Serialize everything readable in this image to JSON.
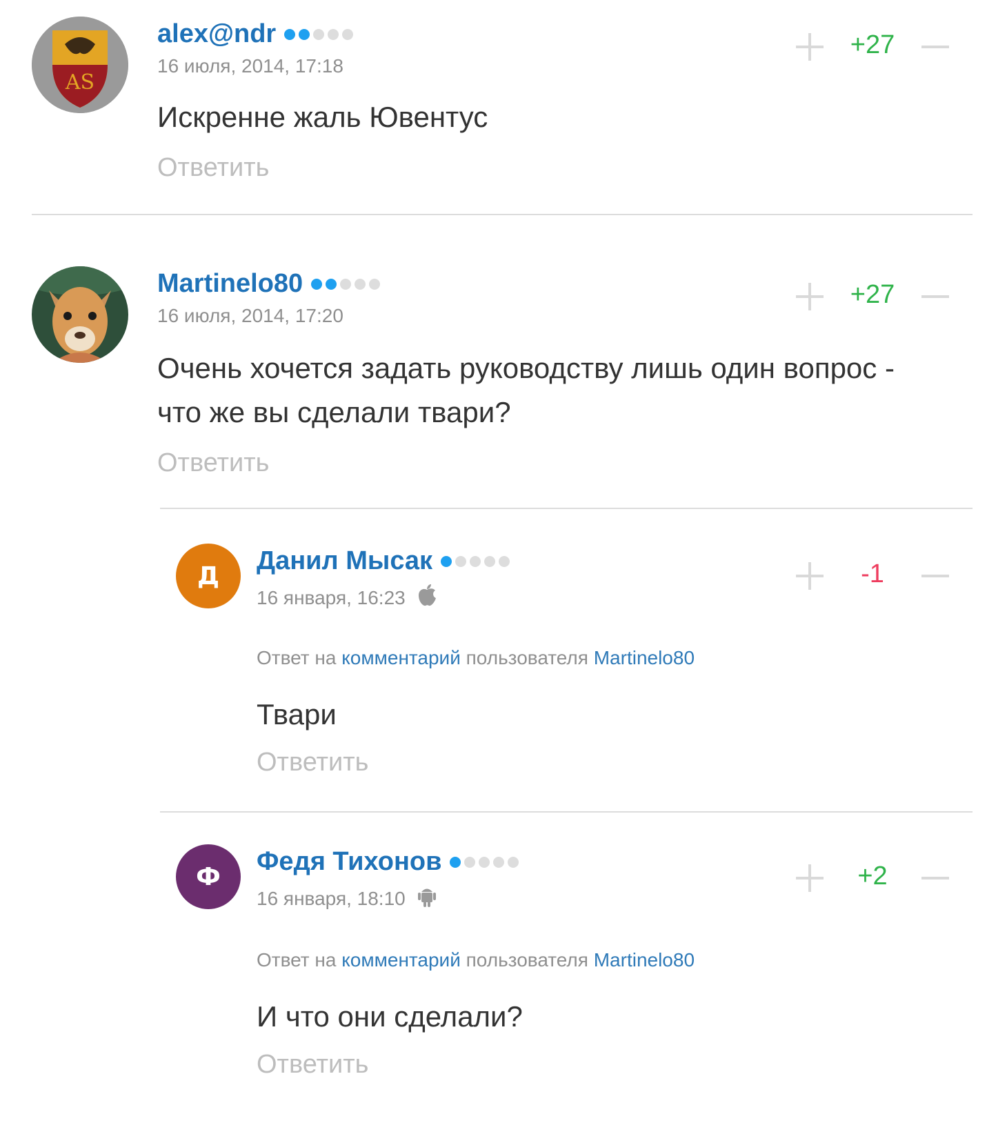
{
  "comments": [
    {
      "username": "alex@ndr",
      "rating_dots": 2,
      "date": "16 июля, 2014, 17:18",
      "text": "Искренне жаль Ювентус",
      "score": "+27",
      "reply_label": "Ответить"
    },
    {
      "username": "Martinelo80",
      "rating_dots": 2,
      "date": "16 июля, 2014, 17:20",
      "text": "Очень хочется задать руководству лишь один вопрос - что же вы сделали твари?",
      "score": "+27",
      "reply_label": "Ответить"
    },
    {
      "username": "Данил Мысак",
      "avatar_letter": "Д",
      "avatar_color": "#e07b0e",
      "rating_dots": 1,
      "date": "16 января, 16:23",
      "platform_icon": "apple-icon",
      "reply_to_prefix": "Ответ на",
      "reply_to_link": "комментарий",
      "reply_to_mid": "пользователя",
      "reply_to_user": "Martinelo80",
      "text": "Твари",
      "score": "-1",
      "reply_label": "Ответить"
    },
    {
      "username": "Федя Тихонов",
      "avatar_letter": "Ф",
      "avatar_color": "#6b2d6e",
      "rating_dots": 1,
      "date": "16 января, 18:10",
      "platform_icon": "android-icon",
      "reply_to_prefix": "Ответ на",
      "reply_to_link": "комментарий",
      "reply_to_mid": "пользователя",
      "reply_to_user": "Martinelo80",
      "text": "И что они сделали?",
      "score": "+2",
      "reply_label": "Ответить"
    }
  ],
  "colors": {
    "username": "#1f72b8",
    "positive_score": "#2fb34a",
    "negative_score": "#ee3c5e",
    "rating_dot_on": "#1ea0f0"
  }
}
